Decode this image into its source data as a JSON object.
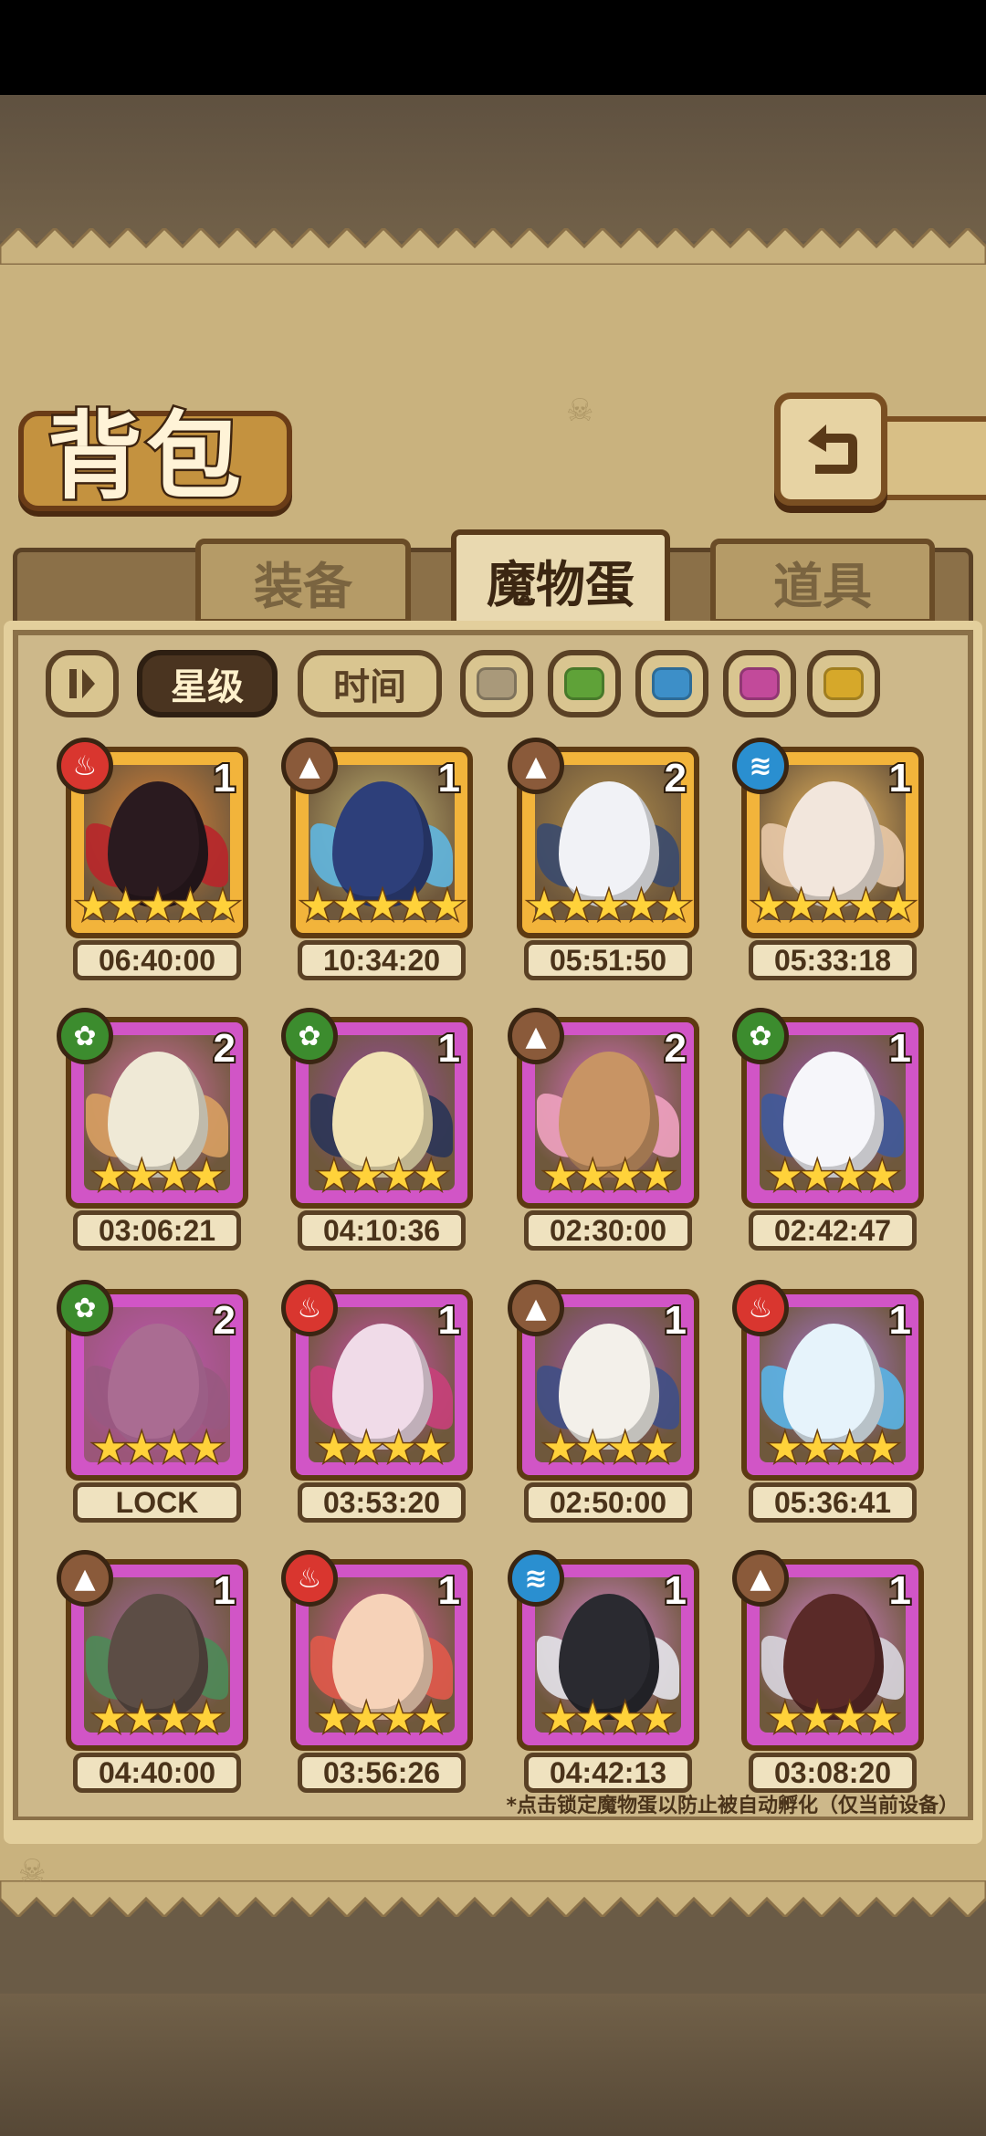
{
  "title": "背包",
  "tabs": [
    {
      "label": "装备",
      "active": false
    },
    {
      "label": "魔物蛋",
      "active": true
    },
    {
      "label": "道具",
      "active": false
    }
  ],
  "filters": {
    "sort_icon": "sort-toggle-icon",
    "star_label": "星级",
    "time_label": "时间",
    "color_swatches": [
      "#a9997a",
      "#5fa238",
      "#3d8fc8",
      "#c24a9a",
      "#d6a82a"
    ]
  },
  "eggs": [
    {
      "element": "fire",
      "element_color": "#d9362f",
      "count": "1",
      "stars": 5,
      "rarity": "gold",
      "time": "06:40:00",
      "egg_color": "#2a1a1f",
      "accent": "#b8262b"
    },
    {
      "element": "earth",
      "element_color": "#8a5a3a",
      "count": "1",
      "stars": 5,
      "rarity": "gold",
      "time": "10:34:20",
      "egg_color": "#2d3f7a",
      "accent": "#5fb6e0"
    },
    {
      "element": "earth",
      "element_color": "#8a5a3a",
      "count": "2",
      "stars": 5,
      "rarity": "gold",
      "time": "05:51:50",
      "egg_color": "#f1f2f6",
      "accent": "#3a4a6e"
    },
    {
      "element": "water",
      "element_color": "#2a8fd0",
      "count": "1",
      "stars": 5,
      "rarity": "gold",
      "time": "05:33:18",
      "egg_color": "#f2e6dc",
      "accent": "#e8c9a8"
    },
    {
      "element": "grass",
      "element_color": "#3c8c2e",
      "count": "2",
      "stars": 4,
      "rarity": "purple",
      "time": "03:06:21",
      "egg_color": "#efe9d6",
      "accent": "#d8a062"
    },
    {
      "element": "grass",
      "element_color": "#3c8c2e",
      "count": "1",
      "stars": 4,
      "rarity": "purple",
      "time": "04:10:36",
      "egg_color": "#f1e3b4",
      "accent": "#2a3556"
    },
    {
      "element": "earth",
      "element_color": "#8a5a3a",
      "count": "2",
      "stars": 4,
      "rarity": "purple",
      "time": "02:30:00",
      "egg_color": "#c89464",
      "accent": "#f0a2c0"
    },
    {
      "element": "grass",
      "element_color": "#3c8c2e",
      "count": "1",
      "stars": 4,
      "rarity": "purple",
      "time": "02:42:47",
      "egg_color": "#f6f6fa",
      "accent": "#3f5a9a"
    },
    {
      "element": "grass",
      "element_color": "#3c8c2e",
      "count": "2",
      "stars": 4,
      "rarity": "purple",
      "time": "LOCK",
      "egg_color": "#8c8068",
      "accent": "#6a5c48"
    },
    {
      "element": "fire",
      "element_color": "#d9362f",
      "count": "1",
      "stars": 4,
      "rarity": "purple",
      "time": "03:53:20",
      "egg_color": "#f0dbe8",
      "accent": "#c8407a"
    },
    {
      "element": "earth",
      "element_color": "#8a5a3a",
      "count": "1",
      "stars": 4,
      "rarity": "purple",
      "time": "02:50:00",
      "egg_color": "#f3f0ea",
      "accent": "#3f4f86"
    },
    {
      "element": "fire",
      "element_color": "#d9362f",
      "count": "1",
      "stars": 4,
      "rarity": "purple",
      "time": "05:36:41",
      "egg_color": "#e6f3fb",
      "accent": "#5ab4e6"
    },
    {
      "element": "earth",
      "element_color": "#8a5a3a",
      "count": "1",
      "stars": 4,
      "rarity": "purple",
      "time": "04:40:00",
      "egg_color": "#5c4d45",
      "accent": "#4e8a58"
    },
    {
      "element": "fire",
      "element_color": "#d9362f",
      "count": "1",
      "stars": 4,
      "rarity": "purple",
      "time": "03:56:26",
      "egg_color": "#f6d2b8",
      "accent": "#e05a4a"
    },
    {
      "element": "water",
      "element_color": "#2a8fd0",
      "count": "1",
      "stars": 4,
      "rarity": "purple",
      "time": "04:42:13",
      "egg_color": "#2a2a30",
      "accent": "#e4e4ea"
    },
    {
      "element": "earth",
      "element_color": "#8a5a3a",
      "count": "1",
      "stars": 4,
      "rarity": "purple",
      "time": "03:08:20",
      "egg_color": "#5a2a28",
      "accent": "#d8d6de"
    }
  ],
  "hint": "*点击锁定魔物蛋以防止被自动孵化（仅当前设备）"
}
